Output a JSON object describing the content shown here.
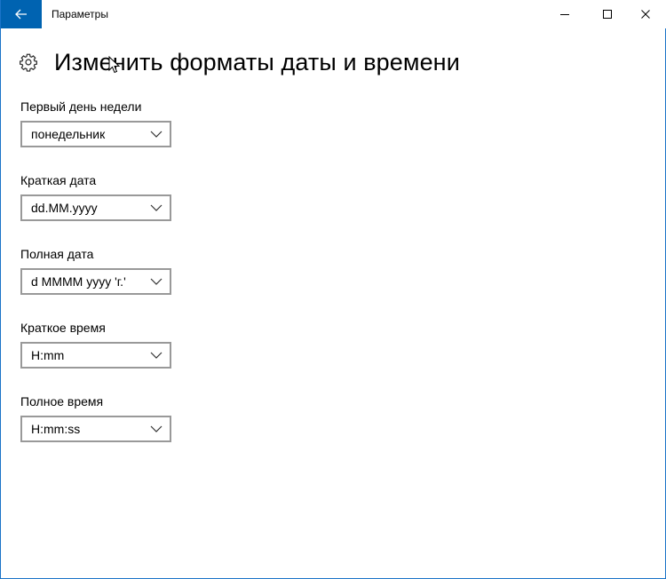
{
  "window": {
    "title": "Параметры"
  },
  "page": {
    "title": "Изменить форматы даты и времени"
  },
  "fields": [
    {
      "label": "Первый день недели",
      "value": "понедельник"
    },
    {
      "label": "Краткая дата",
      "value": "dd.MM.yyyy"
    },
    {
      "label": "Полная дата",
      "value": "d MMMM yyyy 'г.'"
    },
    {
      "label": "Краткое время",
      "value": "H:mm"
    },
    {
      "label": "Полное время",
      "value": "H:mm:ss"
    }
  ],
  "colors": {
    "accent": "#0063b1",
    "border": "#999999"
  },
  "icons": {
    "back": "arrow-left-icon",
    "minimize": "minimize-icon",
    "maximize": "maximize-icon",
    "close": "close-icon",
    "settings": "gear-icon",
    "dropdown": "chevron-down-icon"
  }
}
